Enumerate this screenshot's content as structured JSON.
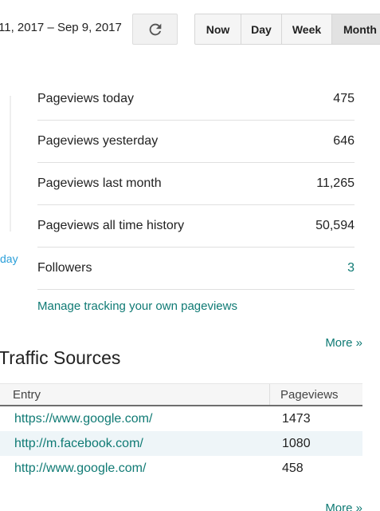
{
  "header": {
    "date_range": "11, 2017 – Sep 9, 2017",
    "refresh_icon": "refresh-icon",
    "range_buttons": [
      "Now",
      "Day",
      "Week",
      "Month"
    ],
    "active_range": "Month"
  },
  "sidebar_fragment": {
    "text": "day"
  },
  "stats": [
    {
      "label": "Pageviews today",
      "value": "475"
    },
    {
      "label": "Pageviews yesterday",
      "value": "646"
    },
    {
      "label": "Pageviews last month",
      "value": "11,265"
    },
    {
      "label": "Pageviews all time history",
      "value": "50,594"
    },
    {
      "label": "Followers",
      "value": "3"
    }
  ],
  "manage_link": "Manage tracking your own pageviews",
  "more_link": "More »",
  "traffic_sources": {
    "title": "Traffic Sources",
    "columns": [
      "Entry",
      "Pageviews"
    ],
    "rows": [
      {
        "entry": "https://www.google.com/",
        "pageviews": "1473"
      },
      {
        "entry": "http://m.facebook.com/",
        "pageviews": "1080"
      },
      {
        "entry": "http://www.google.com/",
        "pageviews": "458"
      }
    ]
  },
  "colors": {
    "link": "#0f7a74",
    "accent_blue": "#2b9fd9",
    "header_border": "#6e6e6e"
  }
}
